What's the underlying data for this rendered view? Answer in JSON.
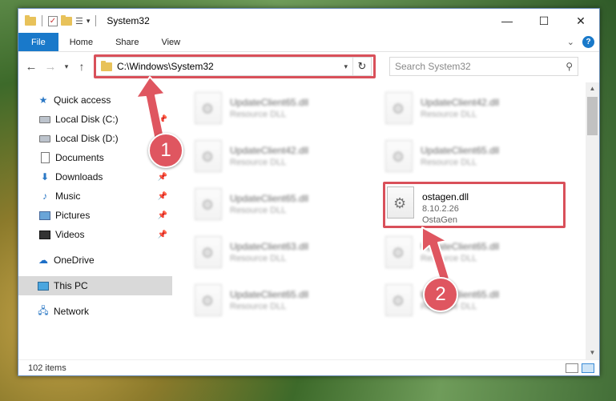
{
  "window": {
    "title": "System32",
    "controls": {
      "minimize": "—",
      "maximize": "☐",
      "close": "✕"
    }
  },
  "ribbon": {
    "tabs": [
      "File",
      "Home",
      "Share",
      "View"
    ]
  },
  "navbar": {
    "address": "C:\\Windows\\System32",
    "search_placeholder": "Search System32"
  },
  "sidebar": {
    "quick_access": "Quick access",
    "items": [
      {
        "label": "Local Disk (C:)",
        "pinned": true
      },
      {
        "label": "Local Disk (D:)",
        "pinned": true
      },
      {
        "label": "Documents",
        "pinned": true
      },
      {
        "label": "Downloads",
        "pinned": true
      },
      {
        "label": "Music",
        "pinned": true
      },
      {
        "label": "Pictures",
        "pinned": true
      },
      {
        "label": "Videos",
        "pinned": true
      }
    ],
    "onedrive": "OneDrive",
    "this_pc": "This PC",
    "network": "Network"
  },
  "files": {
    "left_column": [
      {
        "name": "UpdateClient65.dll",
        "type": "Resource DLL"
      },
      {
        "name": "UpdateClient42.dll",
        "type": "Resource DLL"
      },
      {
        "name": "UpdateClient65.dll",
        "type": "Resource DLL"
      },
      {
        "name": "UpdateClient63.dll",
        "type": "Resource DLL"
      },
      {
        "name": "UpdateClient65.dll",
        "type": "Resource DLL"
      }
    ],
    "right_column": [
      {
        "name": "UpdateClient42.dll",
        "type": "Resource DLL"
      },
      {
        "name": "UpdateClient65.dll",
        "type": "Resource DLL"
      },
      {
        "name": "UpdateClient65.dll",
        "type": "Resource DLL"
      },
      {
        "name": "UpdateClient65.dll",
        "type": "Resource DLL"
      }
    ],
    "highlighted": {
      "name": "ostagen.dll",
      "version": "8.10.2.26",
      "company": "OstaGen"
    }
  },
  "status": {
    "item_count": "102 items"
  },
  "annotations": {
    "step1": "1",
    "step2": "2",
    "color": "#df5660"
  }
}
